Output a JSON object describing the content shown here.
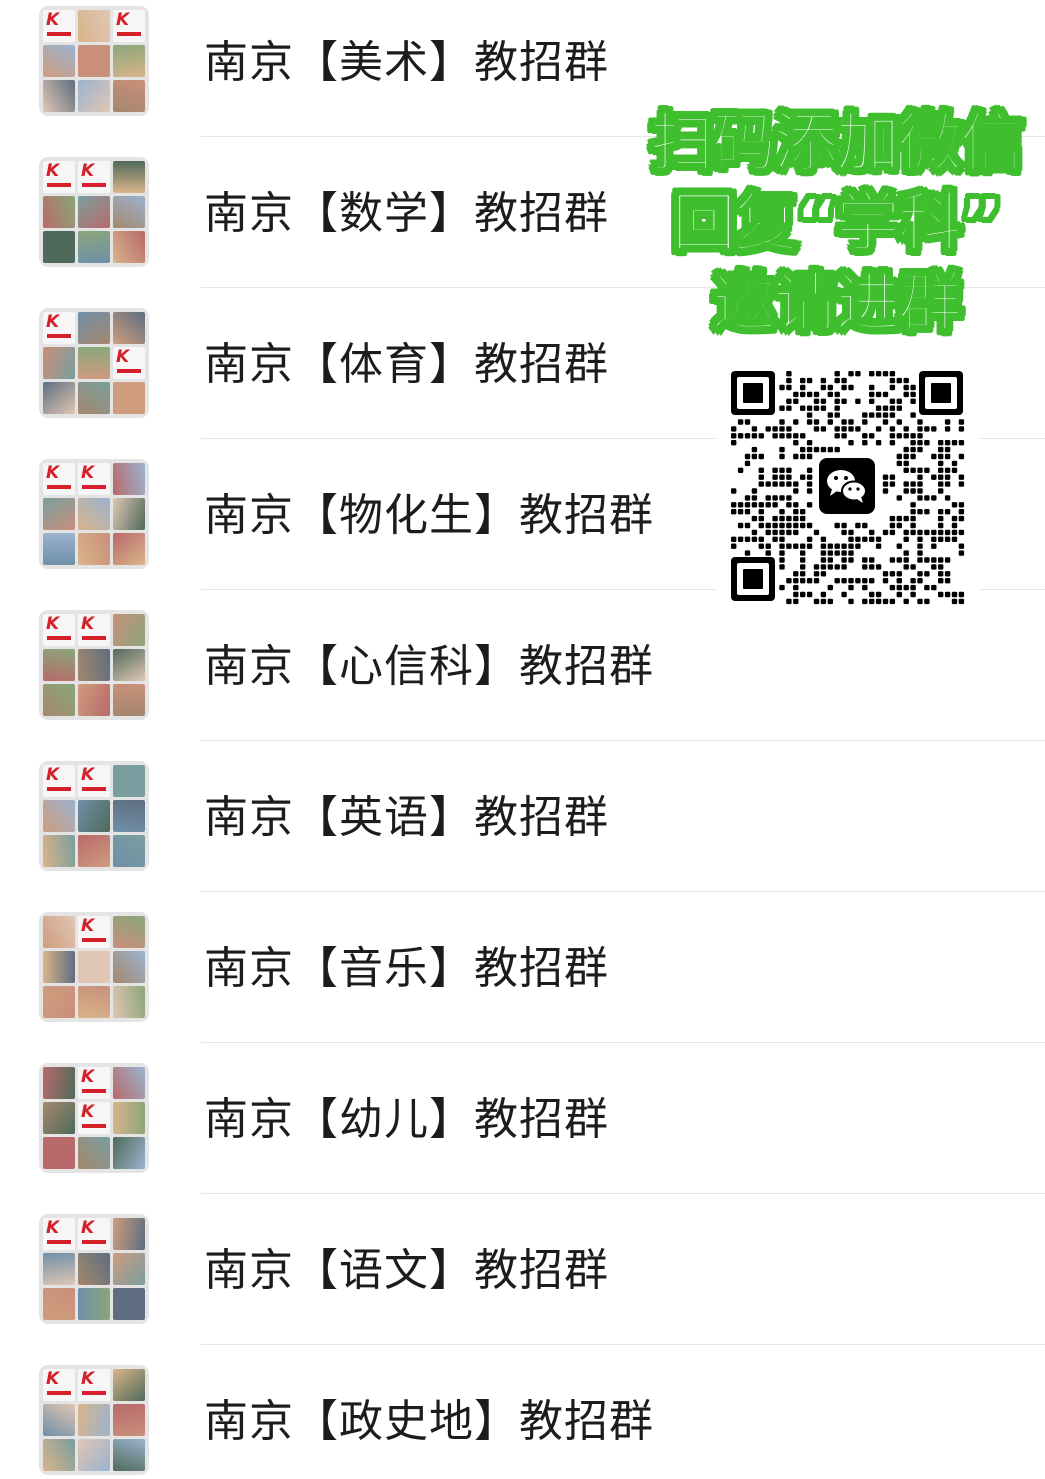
{
  "groups": [
    {
      "label": "南京【美术】教招群"
    },
    {
      "label": "南京【数学】教招群"
    },
    {
      "label": "南京【体育】教招群"
    },
    {
      "label": "南京【物化生】教招群"
    },
    {
      "label": "南京【心信科】教招群"
    },
    {
      "label": "南京【英语】教招群"
    },
    {
      "label": "南京【音乐】教招群"
    },
    {
      "label": "南京【幼儿】教招群"
    },
    {
      "label": "南京【语文】教招群"
    },
    {
      "label": "南京【政史地】教招群"
    }
  ],
  "promo": {
    "line1": "扫码添加微信",
    "line2": "回复“学科”",
    "line3": "邀请进群"
  },
  "qr": {
    "center_icon": "wechat-icon"
  },
  "colors": {
    "promo_green": "#3fbe2e",
    "logo_red": "#d5202a",
    "text": "#1c1c1c",
    "divider": "#e7e7e7"
  }
}
